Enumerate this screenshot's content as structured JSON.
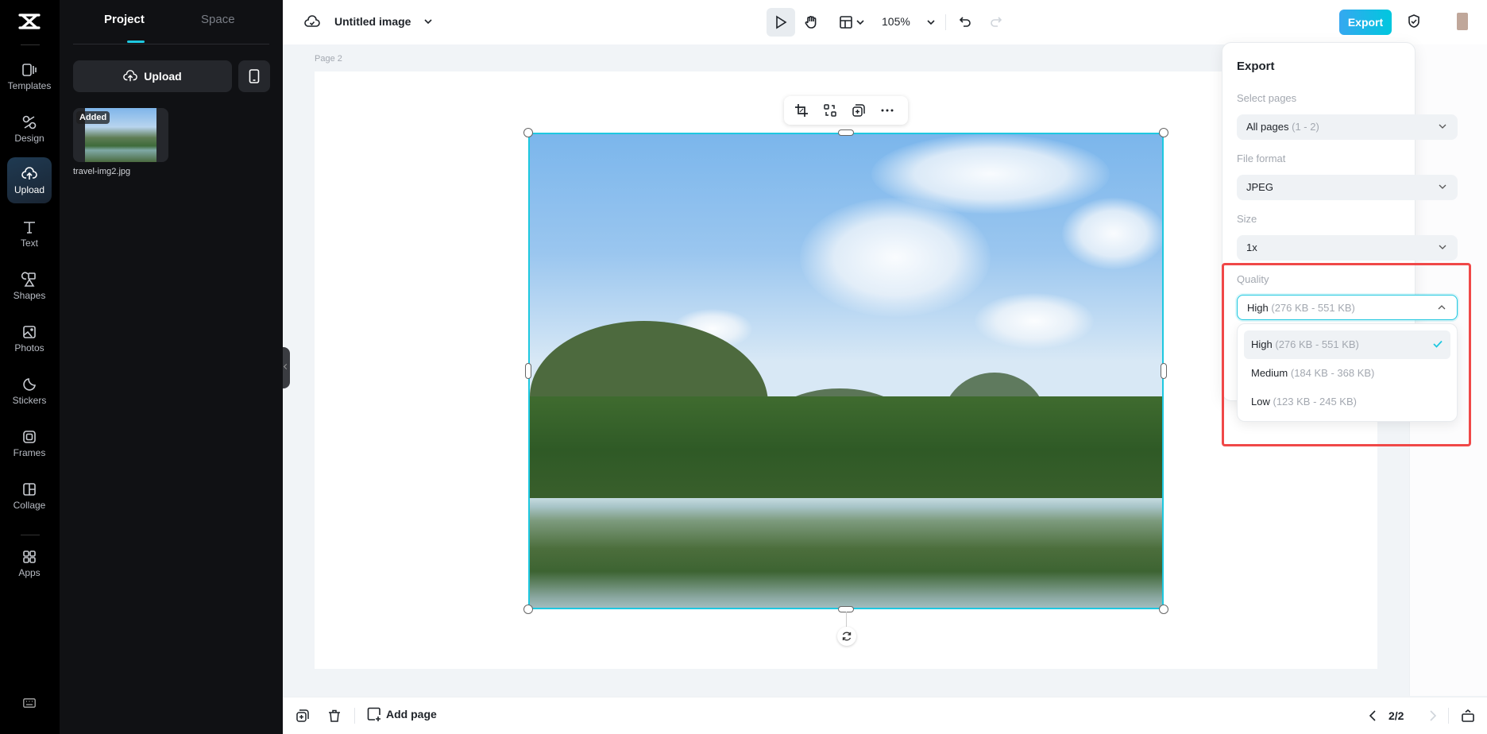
{
  "rail": {
    "items": [
      {
        "id": "templates",
        "label": "Templates",
        "icon": "templates-icon"
      },
      {
        "id": "design",
        "label": "Design",
        "icon": "design-icon"
      },
      {
        "id": "upload",
        "label": "Upload",
        "icon": "upload-cloud-icon",
        "active": true
      },
      {
        "id": "text",
        "label": "Text",
        "icon": "text-icon"
      },
      {
        "id": "shapes",
        "label": "Shapes",
        "icon": "shapes-icon"
      },
      {
        "id": "photos",
        "label": "Photos",
        "icon": "photos-icon"
      },
      {
        "id": "stickers",
        "label": "Stickers",
        "icon": "stickers-icon"
      },
      {
        "id": "frames",
        "label": "Frames",
        "icon": "frames-icon"
      },
      {
        "id": "collage",
        "label": "Collage",
        "icon": "collage-icon"
      },
      {
        "id": "apps",
        "label": "Apps",
        "icon": "apps-icon"
      }
    ]
  },
  "panel": {
    "tabs": [
      {
        "label": "Project",
        "active": true
      },
      {
        "label": "Space",
        "active": false
      }
    ],
    "upload_label": "Upload",
    "assets": [
      {
        "name": "travel-img2.jpg",
        "badge": "Added"
      }
    ]
  },
  "topbar": {
    "title": "Untitled image",
    "zoom": "105%",
    "export_label": "Export"
  },
  "canvas": {
    "page_label": "Page 2"
  },
  "bottombar": {
    "add_page_label": "Add page",
    "page_indicator": "2/2"
  },
  "export_panel": {
    "title": "Export",
    "select_pages": {
      "label": "Select pages",
      "value": "All pages",
      "hint": "(1 - 2)"
    },
    "file_format": {
      "label": "File format",
      "value": "JPEG"
    },
    "size": {
      "label": "Size",
      "value": "1x"
    },
    "quality": {
      "label": "Quality",
      "value": "High",
      "hint": "(276 KB - 551 KB)",
      "options": [
        {
          "label": "High",
          "hint": "(276 KB - 551 KB)",
          "selected": true
        },
        {
          "label": "Medium",
          "hint": "(184 KB - 368 KB)",
          "selected": false
        },
        {
          "label": "Low",
          "hint": "(123 KB - 245 KB)",
          "selected": false
        }
      ]
    }
  },
  "colors": {
    "accent": "#1ec8e0",
    "export_gradient_start": "#35a8f0",
    "highlight_box": "#f04848"
  }
}
